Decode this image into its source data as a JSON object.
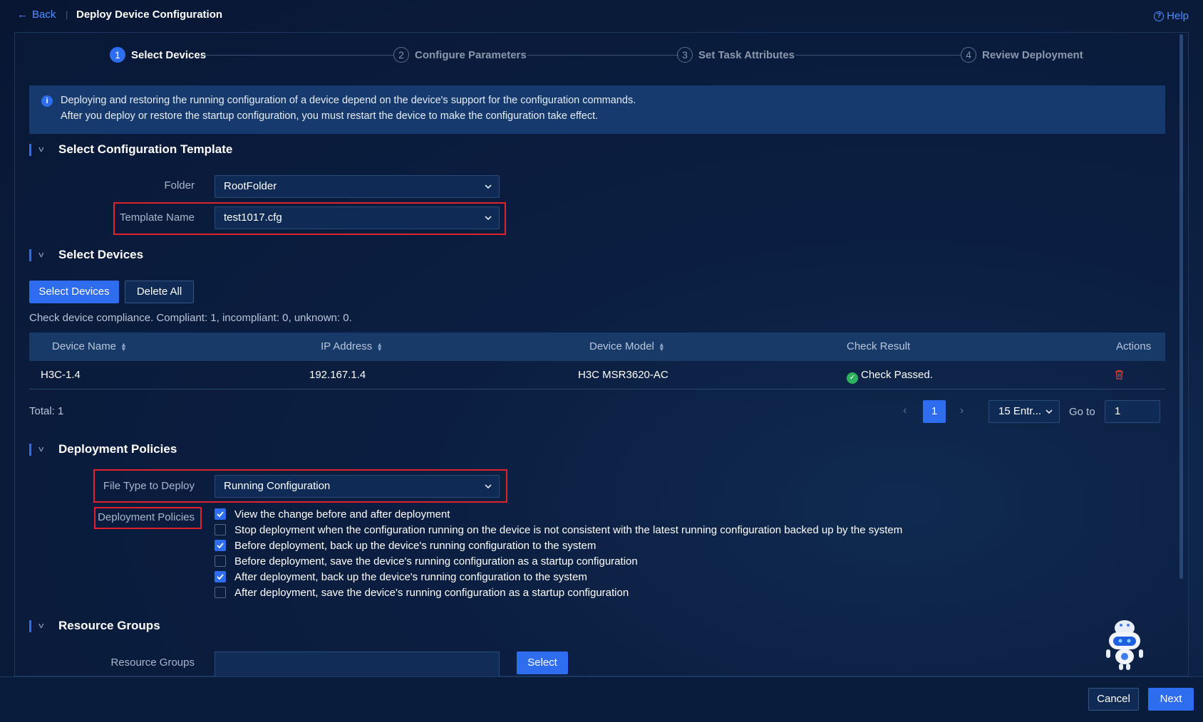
{
  "header": {
    "back_label": "Back",
    "title": "Deploy Device Configuration",
    "help_label": "Help"
  },
  "steps": [
    {
      "num": "1",
      "label": "Select Devices",
      "active": true
    },
    {
      "num": "2",
      "label": "Configure Parameters",
      "active": false
    },
    {
      "num": "3",
      "label": "Set Task Attributes",
      "active": false
    },
    {
      "num": "4",
      "label": "Review Deployment",
      "active": false
    }
  ],
  "info": {
    "line1": "Deploying and restoring the running configuration of a device depend on the device's support for the configuration commands.",
    "line2": "After you deploy or restore the startup configuration, you must restart the device to make the configuration take effect."
  },
  "template_section": {
    "title": "Select Configuration Template",
    "folder_label": "Folder",
    "folder_value": "RootFolder",
    "template_label": "Template Name",
    "template_value": "test1017.cfg"
  },
  "devices_section": {
    "title": "Select Devices",
    "select_button": "Select Devices",
    "delete_all_button": "Delete All",
    "compliance_text": "Check device compliance. Compliant: 1, incompliant: 0, unknown: 0.",
    "columns": [
      "Device Name",
      "IP Address",
      "Device Model",
      "Check Result",
      "Actions"
    ],
    "rows": [
      {
        "name": "H3C-1.4",
        "ip": "192.167.1.4",
        "model": "H3C MSR3620-AC",
        "result": "Check Passed."
      }
    ],
    "total_text": "Total: 1",
    "page": "1",
    "page_size": "15 Entr...",
    "goto_label": "Go to",
    "goto_value": "1"
  },
  "policies_section": {
    "title": "Deployment Policies",
    "file_type_label": "File Type to Deploy",
    "file_type_value": "Running Configuration",
    "policies_label": "Deployment Policies",
    "options": [
      {
        "label": "View the change before and after deployment",
        "checked": true
      },
      {
        "label": "Stop deployment when the configuration running on the device is not consistent with the latest running configuration backed up by the system",
        "checked": false
      },
      {
        "label": "Before deployment, back up the device's running configuration to the system",
        "checked": true
      },
      {
        "label": "Before deployment, save the device's running configuration as a startup configuration",
        "checked": false
      },
      {
        "label": "After deployment, back up the device's running configuration to the system",
        "checked": true
      },
      {
        "label": "After deployment, save the device's running configuration as a startup configuration",
        "checked": false
      }
    ]
  },
  "resource_section": {
    "title": "Resource Groups",
    "label": "Resource Groups",
    "select_button": "Select"
  },
  "footer": {
    "cancel_label": "Cancel",
    "next_label": "Next"
  },
  "colors": {
    "accent": "#2e6cf0",
    "highlight": "#e0232b",
    "success": "#2db35d",
    "danger": "#e0453b"
  }
}
